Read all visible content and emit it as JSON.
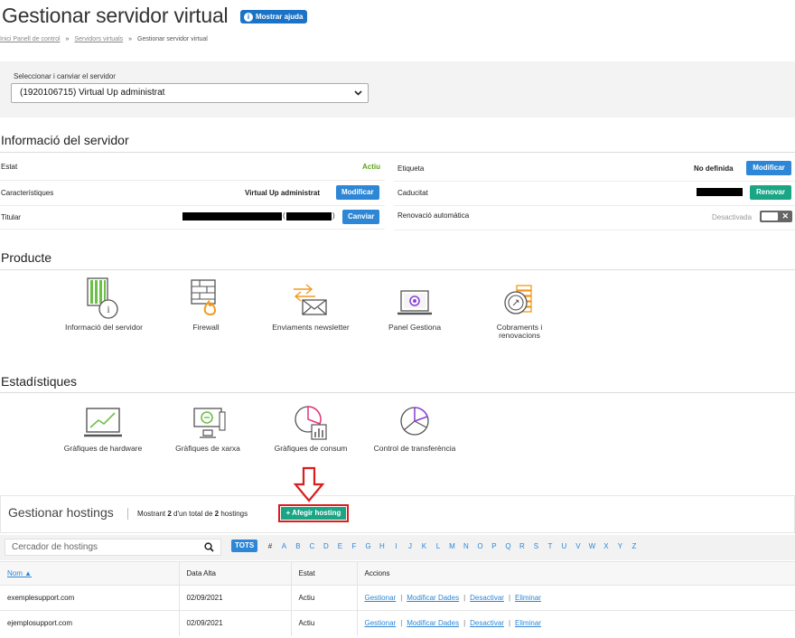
{
  "page": {
    "title": "Gestionar servidor virtual",
    "help_label": "Mostrar ajuda",
    "breadcrumb": [
      "Inici Panell de control",
      "Servidors virtuals",
      "Gestionar servidor virtual"
    ],
    "breadcrumb_sep": "»"
  },
  "server_select": {
    "label": "Seleccionar i canviar el servidor",
    "value": "(1920106715) Virtual Up administrat"
  },
  "info": {
    "heading": "Informació del servidor",
    "left": [
      {
        "label": "Estat",
        "value": "Actiu"
      },
      {
        "label": "Característiques",
        "value": "Virtual Up administrat",
        "button": "Modificar"
      },
      {
        "label": "Titular",
        "value_suffix": "(",
        "value_close": ")",
        "button": "Canviar"
      }
    ],
    "right": [
      {
        "label": "Etiqueta",
        "value": "No definida",
        "button": "Modificar"
      },
      {
        "label": "Caducitat",
        "button": "Renovar"
      },
      {
        "label": "Renovació automàtica",
        "value": "Desactivada",
        "toggle_x": "✕"
      }
    ]
  },
  "producte": {
    "heading": "Producte",
    "items": [
      {
        "label": "Informació del servidor",
        "icon": "server-info-icon"
      },
      {
        "label": "Firewall",
        "icon": "firewall-icon"
      },
      {
        "label": "Enviaments newsletter",
        "icon": "newsletter-icon"
      },
      {
        "label": "Panel Gestiona",
        "icon": "panel-monitor-icon"
      },
      {
        "label_1": "Cobraments i",
        "label_2": "renovacions",
        "icon": "billing-icon"
      }
    ]
  },
  "stats": {
    "heading": "Estadístiques",
    "items": [
      {
        "label": "Gràfiques de hardware",
        "icon": "hardware-chart-icon"
      },
      {
        "label": "Gràfiques de xarxa",
        "icon": "network-chart-icon"
      },
      {
        "label": "Gràfiques de consum",
        "icon": "consumption-chart-icon"
      },
      {
        "label": "Control de transferència",
        "icon": "transfer-control-icon"
      }
    ]
  },
  "hostings": {
    "heading": "Gestionar hostings",
    "showing_prefix": "Mostrant",
    "showing_count": "2",
    "showing_mid": "d'un total de",
    "showing_total": "2",
    "showing_suffix": "hostings",
    "add_label": "+ Afegir hosting",
    "search_placeholder": "Cercador de hostings",
    "tots_label": "TOTS",
    "letters": [
      "#",
      "A",
      "B",
      "C",
      "D",
      "E",
      "F",
      "G",
      "H",
      "I",
      "J",
      "K",
      "L",
      "M",
      "N",
      "O",
      "P",
      "Q",
      "R",
      "S",
      "T",
      "U",
      "V",
      "W",
      "X",
      "Y",
      "Z"
    ],
    "columns": [
      "Nom ▲",
      "Data Alta",
      "Estat",
      "Accions"
    ],
    "rows": [
      {
        "nom": "exemplesupport.com",
        "data": "02/09/2021",
        "estat": "Actiu"
      },
      {
        "nom": "ejemplosupport.com",
        "data": "02/09/2021",
        "estat": "Actiu"
      }
    ],
    "actions": [
      "Gestionar",
      "Modificar Dades",
      "Desactivar",
      "Eliminar"
    ],
    "action_sep": "|"
  },
  "colors": {
    "accent_blue": "#2d86d6",
    "green": "#1aa585",
    "active_green": "#5aa516",
    "highlight_red": "#d81e1e"
  }
}
